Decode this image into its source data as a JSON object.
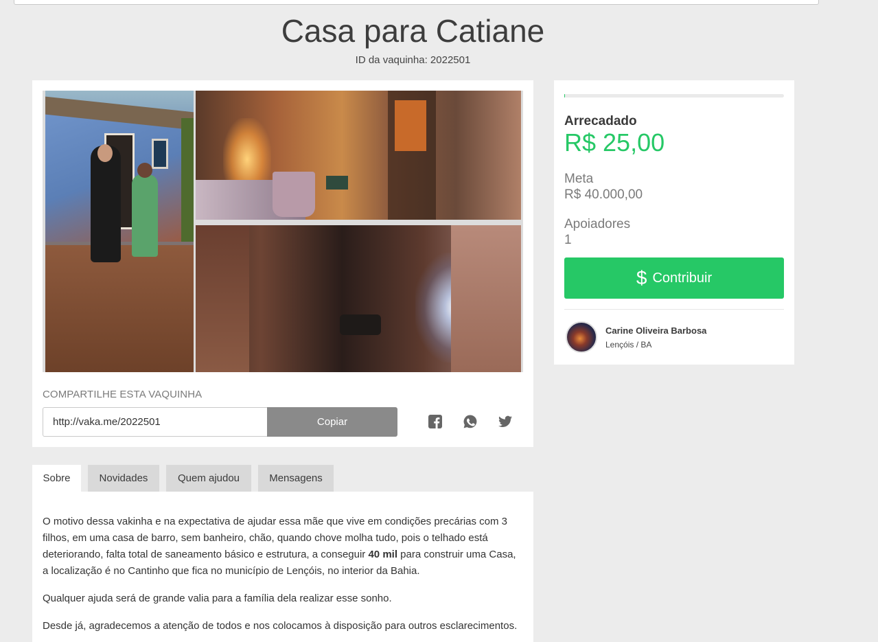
{
  "campaign": {
    "title": "Casa para Catiane",
    "id_text": "ID da vaquinha: 2022501"
  },
  "share": {
    "label": "COMPARTILHE ESTA VAQUINHA",
    "url": "http://vaka.me/2022501",
    "copy_label": "Copiar",
    "networks": [
      "facebook-icon",
      "whatsapp-icon",
      "twitter-icon"
    ]
  },
  "stats": {
    "raised_label": "Arrecadado",
    "raised_value": "R$ 25,00",
    "goal_label": "Meta",
    "goal_value": "R$ 40.000,00",
    "backers_label": "Apoiadores",
    "backers_value": "1",
    "progress_fraction": 0.000625,
    "contribute_label": "Contribuir"
  },
  "owner": {
    "name": "Carine Oliveira Barbosa",
    "location": "Lençóis / BA"
  },
  "tabs": [
    {
      "label": "Sobre"
    },
    {
      "label": "Novidades"
    },
    {
      "label": "Quem ajudou"
    },
    {
      "label": "Mensagens"
    }
  ],
  "about": {
    "p1_before": "O motivo dessa vakinha e na expectativa de ajudar essa mãe que vive em condições precárias com 3 filhos, em uma casa de barro, sem banheiro, chão, quando chove molha tudo, pois o telhado está deteriorando, falta total de saneamento básico e estrutura, a conseguir ",
    "p1_bold": "40 mil",
    "p1_after": " para construir uma Casa,  a localização é no Cantinho que fica no município de Lençóis, no interior da Bahia.",
    "p2": "Qualquer ajuda será de grande valia para a família dela realizar esse sonho.",
    "p3": "Desde já, agradecemos a atenção de todos e nos colocamos à disposição para outros esclarecimentos."
  },
  "colors": {
    "accent": "#26c866",
    "background": "#ececec",
    "copy_button": "#8a8a8a"
  }
}
